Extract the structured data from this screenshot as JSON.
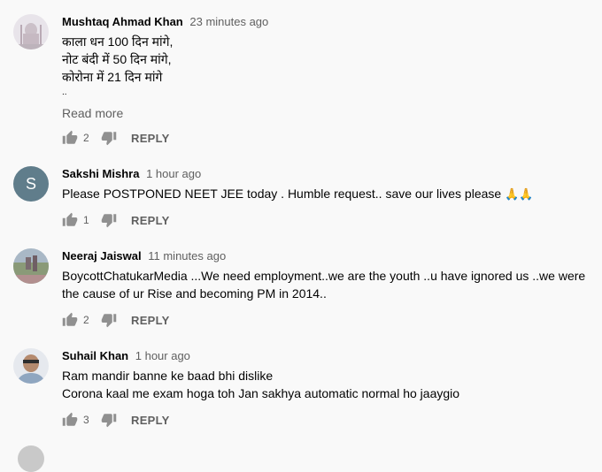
{
  "comments": [
    {
      "author": "Mushtaq Ahmad Khan",
      "time": "23 minutes ago",
      "lines": [
        "काला धन 100 दिन मांगे,",
        "नोट बंदी में 50 दिन मांगे,",
        "कोरोना में 21 दिन मांगे",
        ".."
      ],
      "read_more": "Read more",
      "likes": "2",
      "reply": "REPLY",
      "avatar_icon": "taj-mahal-photo"
    },
    {
      "author": "Sakshi Mishra",
      "time": "1 hour ago",
      "text": "Please POSTPONED NEET JEE today . Humble request.. save our lives please",
      "emoji": "🙏🙏",
      "avatar_letter": "S",
      "avatar_color": "#607d8b",
      "likes": "1",
      "reply": "REPLY"
    },
    {
      "author": "Neeraj Jaiswal",
      "time": "11 minutes ago",
      "text": "BoycottChatukarMedia ...We need employment..we are the youth ..u have ignored us ..we were the cause of ur Rise and becoming PM in 2014..",
      "likes": "2",
      "reply": "REPLY",
      "avatar_icon": "landscape-photo"
    },
    {
      "author": "Suhail Khan",
      "time": "1 hour ago",
      "lines": [
        "Ram mandir banne ke baad bhi dislike",
        "Corona kaal me exam hoga toh Jan sakhya automatic normal ho jaaygio"
      ],
      "likes": "3",
      "reply": "REPLY",
      "avatar_icon": "person-photo"
    }
  ]
}
